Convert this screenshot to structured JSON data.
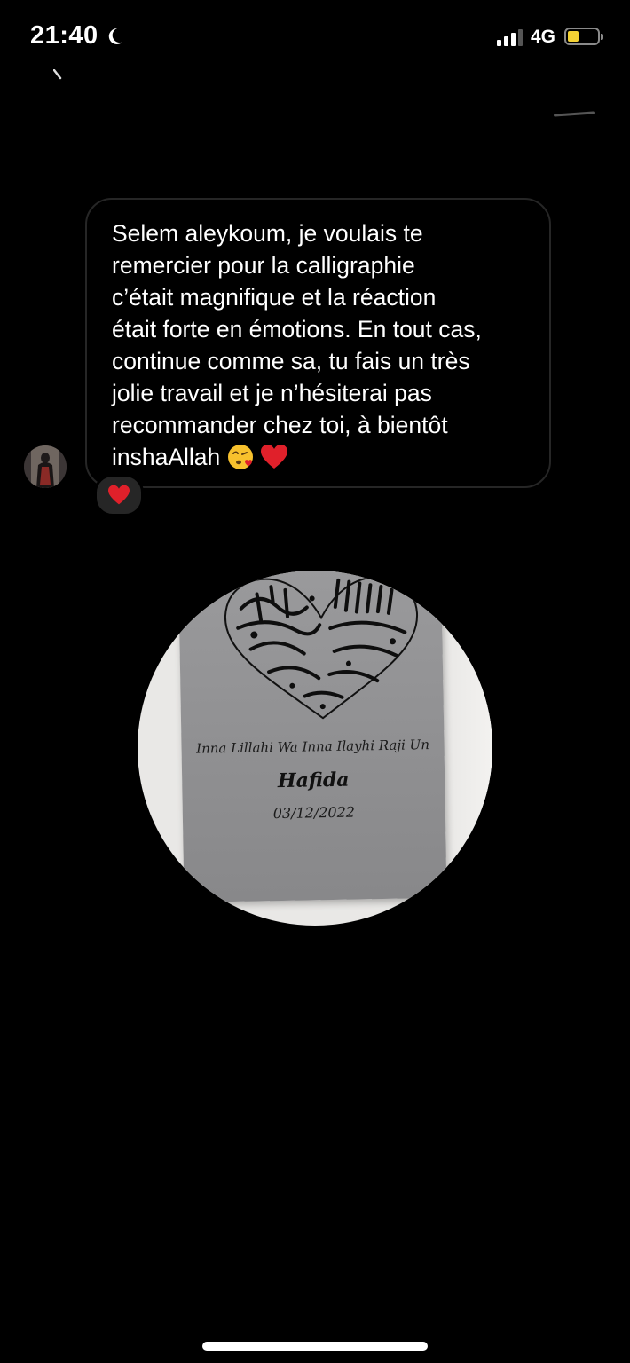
{
  "status_bar": {
    "time": "21:40",
    "network": "4G",
    "battery_level": 0.3,
    "battery_color": "#f4d234"
  },
  "message": {
    "text": "Selem aleykoum, je voulais te\nremercier pour la calligraphie\nc’était magnifique et la réaction\nétait forte en émotions. En tout cas,\ncontinue comme sa, tu fais un très\njolie travail et je n’hésiterai pas\nrecommander chez toi, à bientôt\ninshaAllah",
    "emojis": [
      "face-blowing-kiss",
      "red-heart"
    ],
    "reaction": "red-heart"
  },
  "photo": {
    "line1": "Inna Lillahi Wa Inna Ilayhi Raji Un",
    "name": "Hafida",
    "date": "03/12/2022"
  },
  "colors": {
    "background": "#000000",
    "bubble_border": "#262626",
    "reaction_bg": "#262626",
    "heart": "#e0202a"
  }
}
